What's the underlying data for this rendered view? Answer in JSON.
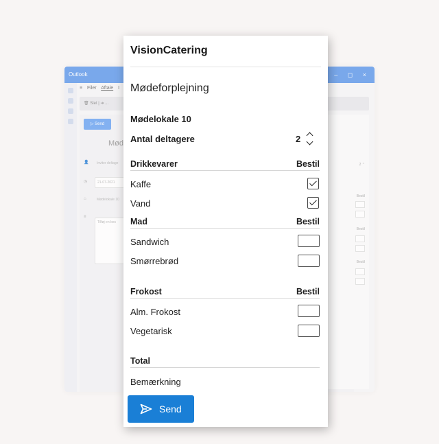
{
  "outlook": {
    "title": "Outlook",
    "window_controls": "– ◻ ×",
    "menu": [
      "≡",
      "Filer",
      "Aftale",
      "I"
    ],
    "toolbar_text": "🗑 Slet   |   ➔ ...",
    "send_label": "▷ Send",
    "subject_placeholder": "Møde me",
    "invite_placeholder": "Inviter deltage",
    "date_value": "21-07-2021",
    "location_value": "Mødelokale 10",
    "body_placeholder": "Tilføj en bes",
    "right_labels": [
      "Bestil",
      "Bestil",
      "Bestil"
    ],
    "right_stepper_value": "2 ⌃"
  },
  "panel": {
    "brand": "VisionCatering",
    "title": "Mødeforplejning",
    "room": "Mødelokale 10",
    "attendees_label": "Antal deltagere",
    "attendees_value": "2",
    "order_header": "Bestil",
    "sections": {
      "drinks": {
        "title": "Drikkevarer",
        "items": [
          {
            "label": "Kaffe",
            "checked": true
          },
          {
            "label": "Vand",
            "checked": true
          }
        ]
      },
      "food": {
        "title": "Mad",
        "items": [
          {
            "label": "Sandwich",
            "checked": false
          },
          {
            "label": "Smørrebrød",
            "checked": false
          }
        ]
      },
      "lunch": {
        "title": "Frokost",
        "items": [
          {
            "label": "Alm. Frokost",
            "checked": false
          },
          {
            "label": "Vegetarisk",
            "checked": false
          }
        ]
      }
    },
    "total_label": "Total",
    "remark_label": "Bemærkning",
    "send_label": "Send"
  },
  "colors": {
    "background": "#f8f5f4",
    "outlook_titlebar": "#4f8fe9",
    "send_button": "#1a7fd6"
  }
}
